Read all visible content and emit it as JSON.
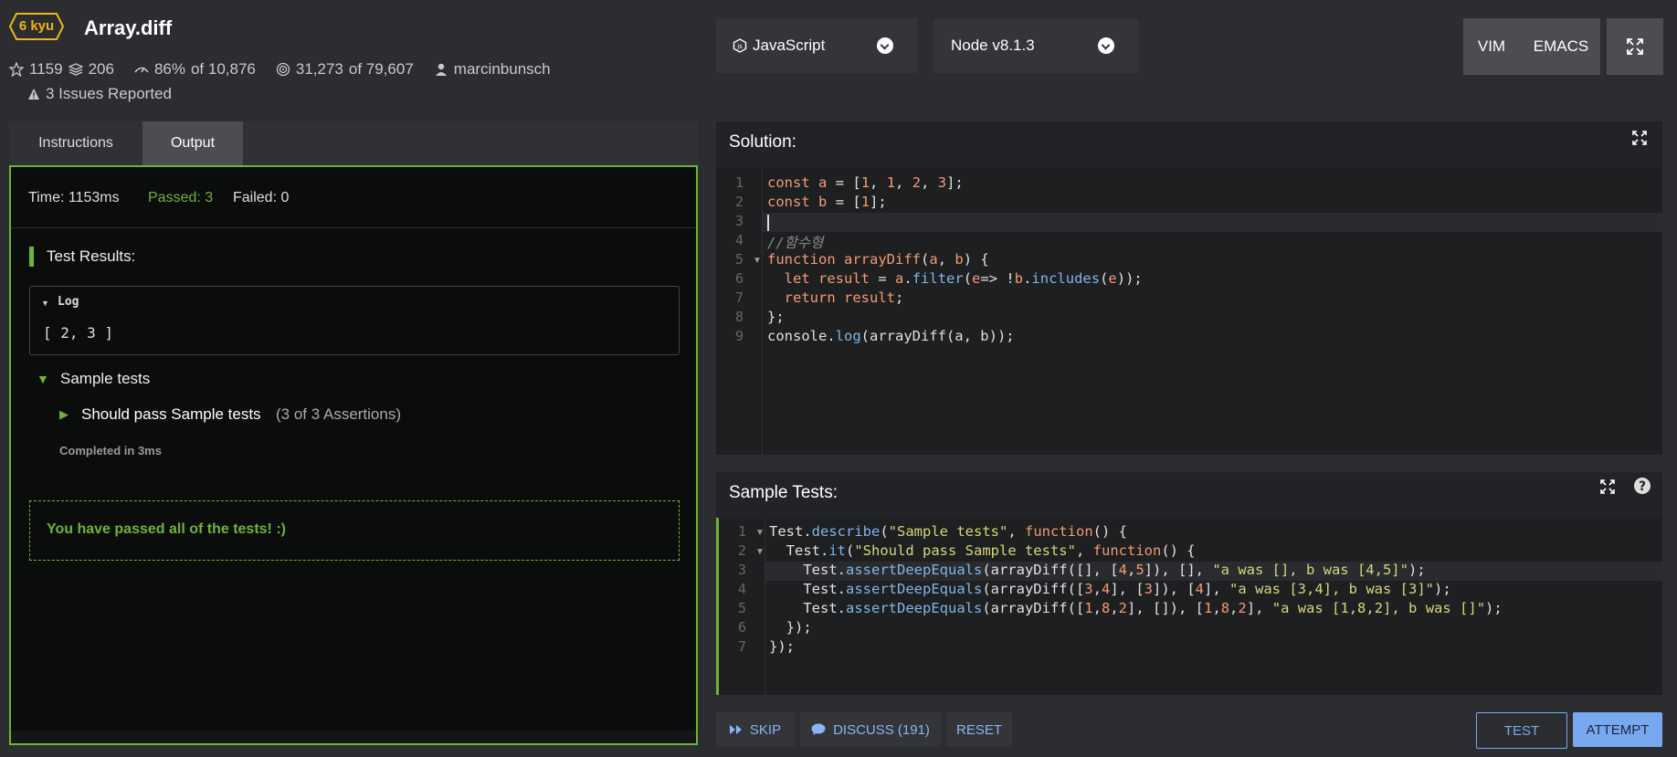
{
  "kata": {
    "rank": "6 kyu",
    "title": "Array.diff",
    "stars": "1159",
    "collections": "206",
    "satisfaction": "86%",
    "satisfaction_of": "of 10,876",
    "completed": "31,273",
    "completed_of": "of 79,607",
    "author": "marcinbunsch",
    "issues": "3 Issues Reported"
  },
  "toolbar": {
    "language": "JavaScript",
    "version": "Node v8.1.3",
    "vim": "VIM",
    "emacs": "EMACS"
  },
  "tabs": [
    "Instructions",
    "Output"
  ],
  "output": {
    "time": "Time: 1153ms",
    "passed": "Passed: 3",
    "failed": "Failed: 0",
    "results_title": "Test Results:",
    "log_title": "Log",
    "log_value": "[ 2, 3 ]",
    "group": "Sample tests",
    "test_name": "Should pass Sample tests",
    "assertions": "(3 of 3 Assertions)",
    "completed_in": "Completed in 3ms",
    "pass_message": "You have passed all of the tests! :)"
  },
  "solution": {
    "title": "Solution:",
    "line_numbers": [
      "1",
      "2",
      "3",
      "4",
      "5",
      "6",
      "7",
      "8",
      "9"
    ]
  },
  "sample_tests": {
    "title": "Sample Tests:",
    "line_numbers": [
      "1",
      "2",
      "3",
      "4",
      "5",
      "6",
      "7"
    ]
  },
  "actions": {
    "skip": "SKIP",
    "discuss": "DISCUSS (191)",
    "reset": "RESET",
    "test": "TEST",
    "attempt": "ATTEMPT"
  },
  "colors": {
    "accent_green": "#6fb33a",
    "rank_yellow": "#ecb613",
    "attempt_blue": "#78a9f0"
  }
}
